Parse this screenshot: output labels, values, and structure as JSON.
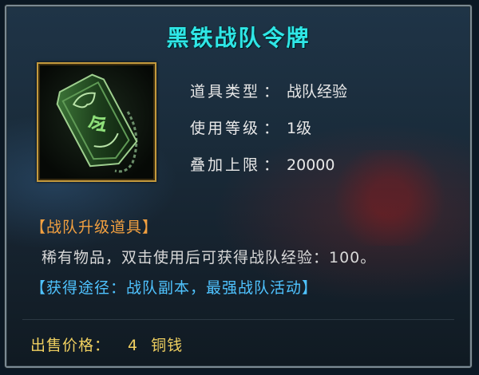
{
  "item": {
    "name": "黑铁战队令牌",
    "properties": [
      {
        "label": "道具类型",
        "separator": "：",
        "value": "战队经验"
      },
      {
        "label": "使用等级",
        "separator": "：",
        "value": "1级"
      },
      {
        "label": "叠加上限",
        "separator": "：",
        "value": "20000"
      }
    ],
    "category_tag": "【战队升级道具】",
    "description": "稀有物品，双击使用后可获得战队经验：100。",
    "source": "【获得途径：战队副本，最强战队活动】",
    "price": {
      "label": "出售价格：",
      "amount": "4",
      "currency": "铜钱"
    },
    "icon": "black-iron-team-token-icon"
  },
  "colors": {
    "title": "#2fe6e6",
    "category_tag": "#f2a040",
    "source": "#4fc3ff",
    "price": "#f0d060",
    "icon_border": "#c49a3d"
  }
}
